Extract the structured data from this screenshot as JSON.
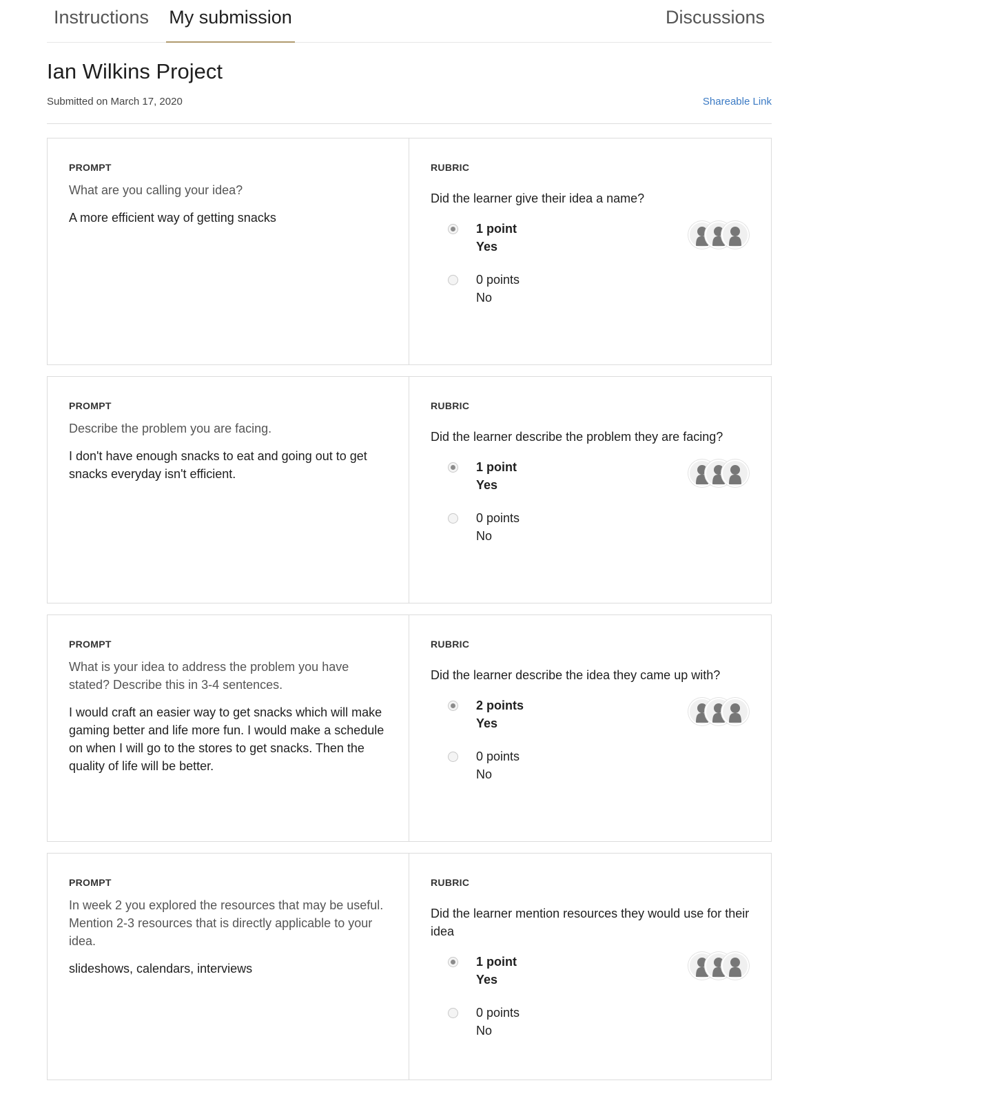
{
  "tabs": {
    "instructions": "Instructions",
    "submission": "My submission",
    "discussions": "Discussions"
  },
  "header": {
    "title": "Ian Wilkins Project",
    "submitted": "Submitted on March 17, 2020",
    "share_link": "Shareable Link"
  },
  "labels": {
    "prompt": "PROMPT",
    "rubric": "RUBRIC"
  },
  "cards": [
    {
      "prompt_question": "What are you calling your idea?",
      "prompt_answer": "A more efficient way of getting snacks",
      "rubric_question": "Did the learner give their idea a name?",
      "options": [
        {
          "points": "1 point",
          "desc": "Yes",
          "selected": true
        },
        {
          "points": "0 points",
          "desc": "No",
          "selected": false
        }
      ]
    },
    {
      "prompt_question": "Describe the problem you are facing.",
      "prompt_answer": "I don't have enough snacks to eat and going out to get snacks everyday isn't efficient.",
      "rubric_question": "Did the learner describe the problem they are facing?",
      "options": [
        {
          "points": "1 point",
          "desc": "Yes",
          "selected": true
        },
        {
          "points": "0 points",
          "desc": "No",
          "selected": false
        }
      ]
    },
    {
      "prompt_question": "What is your idea to address the problem you have stated? Describe this in 3-4 sentences.",
      "prompt_answer": "I would craft an easier way to get snacks which will make gaming better and life more fun. I would make a schedule on when I will go to the stores to get snacks. Then the quality of life will be better.",
      "rubric_question": "Did the learner describe the idea they came up with?",
      "options": [
        {
          "points": "2 points",
          "desc": "Yes",
          "selected": true
        },
        {
          "points": "0 points",
          "desc": "No",
          "selected": false
        }
      ]
    },
    {
      "prompt_question": "In week 2 you explored the resources that may be useful. Mention 2-3 resources that is directly applicable to your idea.",
      "prompt_answer": "slideshows, calendars, interviews",
      "rubric_question": "Did the learner mention resources they would use for their idea",
      "options": [
        {
          "points": "1 point",
          "desc": "Yes",
          "selected": true
        },
        {
          "points": "0 points",
          "desc": "No",
          "selected": false
        }
      ]
    }
  ],
  "icons": {
    "radio": "radio-icon",
    "avatar": "peer-avatar-icon"
  },
  "colors": {
    "link": "#3b7ac4",
    "tab_underline": "#b09a6e",
    "border": "#dcdcdc"
  }
}
